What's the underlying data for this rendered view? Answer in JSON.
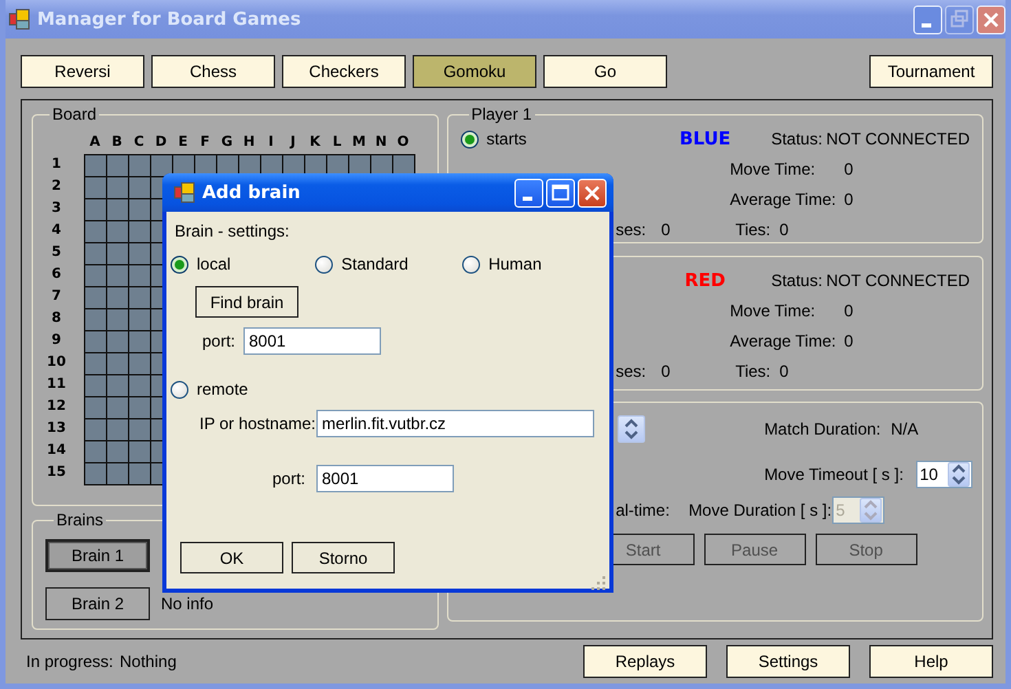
{
  "window": {
    "title": "Manager for Board Games"
  },
  "games": [
    {
      "label": "Reversi",
      "selected": false
    },
    {
      "label": "Chess",
      "selected": false
    },
    {
      "label": "Checkers",
      "selected": false
    },
    {
      "label": "Gomoku",
      "selected": true
    },
    {
      "label": "Go",
      "selected": false
    }
  ],
  "tournament_button": "Tournament",
  "board": {
    "title": "Board",
    "columns": [
      "A",
      "B",
      "C",
      "D",
      "E",
      "F",
      "G",
      "H",
      "I",
      "J",
      "K",
      "L",
      "M",
      "N",
      "O"
    ],
    "rows": [
      "1",
      "2",
      "3",
      "4",
      "5",
      "6",
      "7",
      "8",
      "9",
      "10",
      "11",
      "12",
      "13",
      "14",
      "15"
    ]
  },
  "brains": {
    "title": "Brains",
    "buttons": [
      {
        "label": "Brain 1",
        "focused": true
      },
      {
        "label": "Brain 2",
        "focused": false,
        "info": "No info"
      }
    ]
  },
  "players": [
    {
      "title": "Player 1",
      "starts": {
        "label": "starts",
        "selected": true
      },
      "color_name": "BLUE",
      "color": "#0000ff",
      "status_label": "Status:",
      "status": "NOT CONNECTED",
      "move_time_label": "Move Time:",
      "move_time": "0",
      "average_time_label": "Average Time:",
      "average_time": "0",
      "losses_label": "ses:",
      "losses": "0",
      "ties_label": "Ties:",
      "ties": "0"
    },
    {
      "color_name": "RED",
      "color": "#ff0000",
      "status_label": "Status:",
      "status": "NOT CONNECTED",
      "move_time_label": "Move Time:",
      "move_time": "0",
      "average_time_label": "Average Time:",
      "average_time": "0",
      "losses_label": "ses:",
      "losses": "0",
      "ties_label": "Ties:",
      "ties": "0"
    }
  ],
  "controls": {
    "match_duration_label": "Match Duration:",
    "match_duration": "N/A",
    "move_timeout_label": "Move Timeout [ s ]:",
    "move_timeout": "10",
    "realtime_label": "al-time:",
    "move_duration_label": "Move Duration [ s ]:",
    "move_duration": {
      "value": "5",
      "disabled": true
    },
    "buttons": [
      {
        "label": "Start",
        "disabled": true
      },
      {
        "label": "Pause",
        "disabled": true
      },
      {
        "label": "Stop",
        "disabled": true
      }
    ]
  },
  "status": {
    "label": "In progress:",
    "value": "Nothing"
  },
  "footer_buttons": [
    "Replays",
    "Settings",
    "Help"
  ],
  "dialog": {
    "title": "Add brain",
    "section": "Brain - settings:",
    "sources": [
      {
        "label": "local",
        "selected": true
      },
      {
        "label": "remote",
        "selected": false
      }
    ],
    "types": [
      {
        "label": "Standard",
        "selected": false
      },
      {
        "label": "Human",
        "selected": false
      }
    ],
    "find_button": "Find brain",
    "local_port_label": "port:",
    "local_port": "8001",
    "host_label": "IP or hostname:",
    "host": "merlin.fit.vutbr.cz",
    "remote_port_label": "port:",
    "remote_port": "8001",
    "buttons": [
      "OK",
      "Storno"
    ]
  }
}
